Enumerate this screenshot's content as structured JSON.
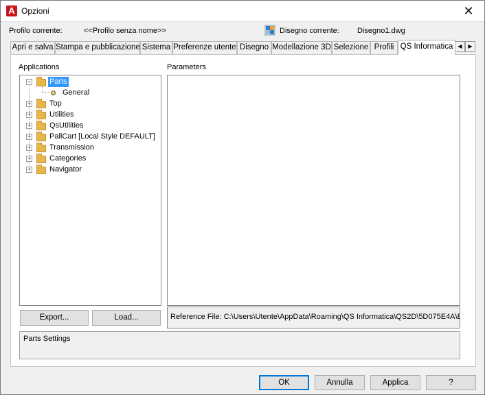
{
  "window": {
    "title": "Opzioni",
    "app_icon": "A",
    "close_icon": "✕"
  },
  "header": {
    "profile_label": "Profilo corrente:",
    "profile_value": "<<Profilo senza nome>>",
    "drawing_label": "Disegno corrente:",
    "drawing_value": "Disegno1.dwg"
  },
  "tabs": [
    {
      "label": "Apri e salva"
    },
    {
      "label": "Stampa e pubblicazione"
    },
    {
      "label": "Sistema"
    },
    {
      "label": "Preferenze utente"
    },
    {
      "label": "Disegno"
    },
    {
      "label": "Modellazione 3D"
    },
    {
      "label": "Selezione"
    },
    {
      "label": "Profili"
    },
    {
      "label": "QS Informatica",
      "active": true
    }
  ],
  "tab_scroll": {
    "left": "◀",
    "right": "▶"
  },
  "applications": {
    "label": "Applications",
    "tree": [
      {
        "label": "Parts",
        "expander": "−",
        "selected": true,
        "children": [
          {
            "label": "General"
          }
        ]
      },
      {
        "label": "Top",
        "expander": "+"
      },
      {
        "label": "Utilities",
        "expander": "+"
      },
      {
        "label": "QsUtilities",
        "expander": "+"
      },
      {
        "label": "PallCart [Local Style DEFAULT]",
        "expander": "+"
      },
      {
        "label": "Transmission",
        "expander": "+"
      },
      {
        "label": "Categories",
        "expander": "+"
      },
      {
        "label": "Navigator",
        "expander": "+"
      }
    ],
    "export_button": "Export...",
    "load_button": "Load..."
  },
  "parameters": {
    "label": "Parameters",
    "reference_file": "Reference File: C:\\Users\\Utente\\AppData\\Roaming\\QS Informatica\\QS2D\\5D075E4A\\E"
  },
  "settings_text": "Parts Settings",
  "footer": {
    "ok": "OK",
    "cancel": "Annulla",
    "apply": "Applica",
    "help": "?"
  },
  "colors": {
    "selection": "#3399ff",
    "default_button_border": "#0078d7",
    "app_icon": "#c8161d",
    "folder": "#e8b74a"
  }
}
